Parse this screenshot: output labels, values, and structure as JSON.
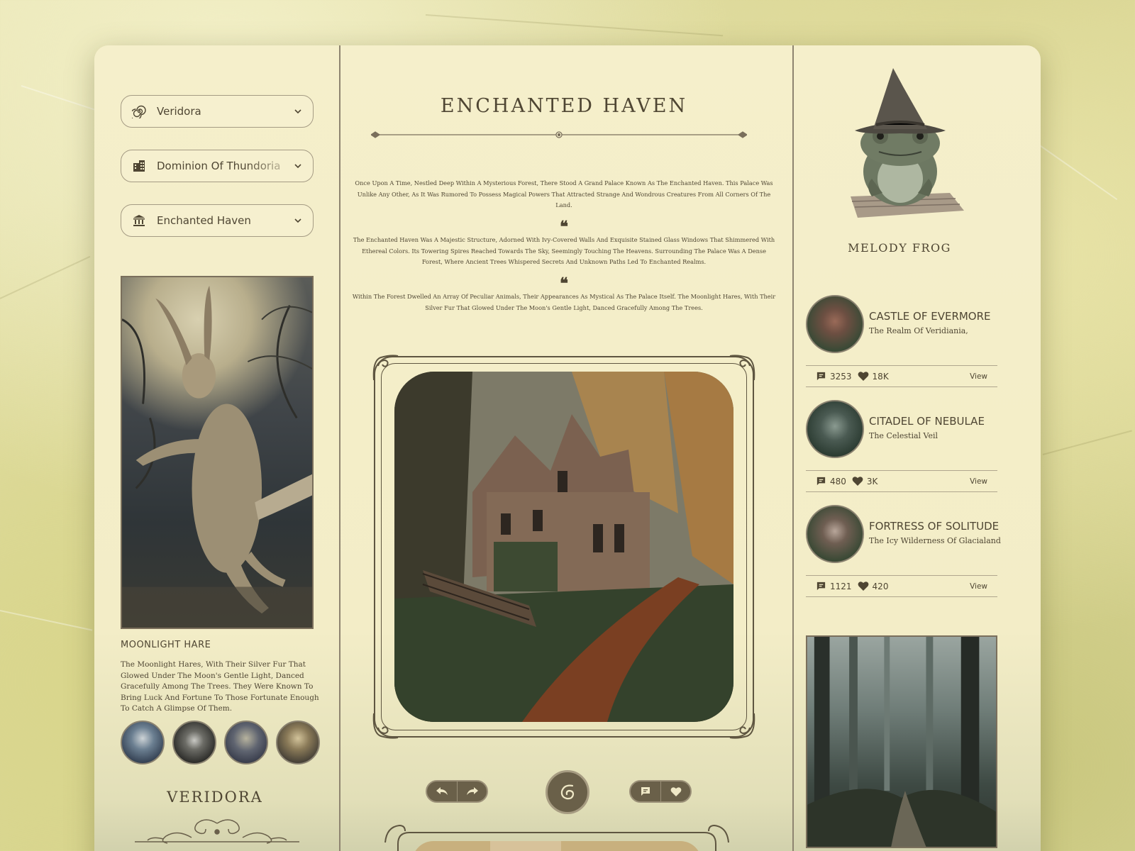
{
  "filters": {
    "realm": {
      "label": "Veridora",
      "icon": "spiral-icon"
    },
    "dominion": {
      "label": "Dominion Of Thundoria",
      "icon": "building-icon"
    },
    "place": {
      "label": "Enchanted Haven",
      "icon": "temple-icon"
    }
  },
  "featured_creature": {
    "title": "MOONLIGHT HARE",
    "description": "The Moonlight Hares, With Their Silver Fur That Glowed Under The Moon's Gentle Light, Danced Gracefully Among The Trees. They Were Known To Bring Luck And Fortune To Those Fortunate Enough To Catch A Glimpse Of Them."
  },
  "region_name": "VERIDORA",
  "main": {
    "title": "ENCHANTED HAVEN",
    "paragraphs": [
      "Once Upon A Time, Nestled Deep Within A Mysterious Forest, There Stood A Grand Palace Known As The Enchanted Haven. This Palace Was Unlike Any Other, As It Was Rumored To Possess Magical Powers That Attracted Strange And Wondrous Creatures From All Corners Of The Land.",
      "The Enchanted Haven Was A Majestic Structure, Adorned With Ivy-Covered Walls And Exquisite Stained Glass Windows That Shimmered With Ethereal Colors. Its Towering Spires Reached Towards The Sky, Seemingly Touching The Heavens. Surrounding The Palace Was A Dense Forest, Where Ancient Trees Whispered Secrets And Unknown Paths Led To Enchanted Realms.",
      "Within The Forest Dwelled An Array Of Peculiar Animals, Their Appearances As Mystical As The Palace Itself. The Moonlight Hares, With Their Silver Fur That Glowed Under The Moon's Gentle Light, Danced Gracefully Among The Trees."
    ],
    "quote_mark": "❝"
  },
  "character": {
    "name": "MELODY FROG"
  },
  "castles": [
    {
      "name": "CASTLE OF EVERMORE",
      "subtitle": "The Realm Of Veridiania,",
      "comments": "3253",
      "likes": "18K",
      "action": "View"
    },
    {
      "name": "CITADEL OF NEBULAE",
      "subtitle": "The Celestial Veil",
      "comments": "480",
      "likes": "3K",
      "action": "View"
    },
    {
      "name": "FORTRESS OF SOLITUDE",
      "subtitle": "The Icy Wilderness Of Glacialand",
      "comments": "1121",
      "likes": "420",
      "action": "View"
    }
  ],
  "colors": {
    "ink": "#4f4633",
    "panel": "#f5efcb",
    "accent": "#6a6049"
  }
}
